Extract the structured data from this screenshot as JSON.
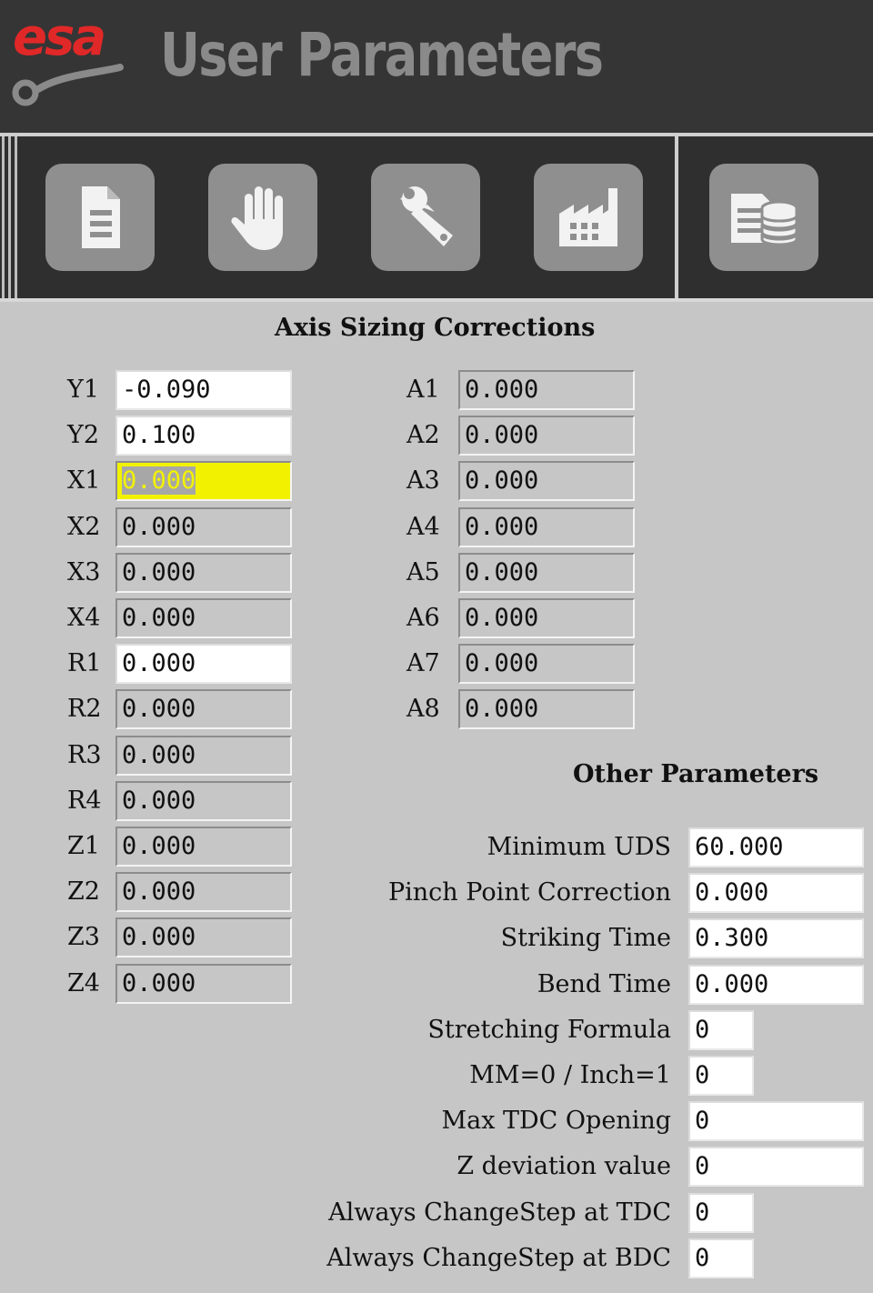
{
  "app": {
    "logo_text": "esa",
    "title": "User Parameters"
  },
  "toolbar": {
    "buttons": [
      {
        "name": "document-button",
        "icon": "document-icon"
      },
      {
        "name": "manual-button",
        "icon": "hand-icon"
      },
      {
        "name": "tools-button",
        "icon": "wrench-icon"
      },
      {
        "name": "factory-button",
        "icon": "factory-icon"
      },
      {
        "name": "database-button",
        "icon": "database-icon"
      }
    ]
  },
  "colors": {
    "header_bg": "#353535",
    "toolbar_bg": "#2f2f2f",
    "panel_bg": "#c6c6c6",
    "title_gray": "#8a8a8a",
    "logo_red": "#e02828",
    "highlight_yellow": "#f2f200"
  },
  "axis_sizing": {
    "title": "Axis Sizing Corrections",
    "left": [
      {
        "label": "Y1",
        "value": "-0.090",
        "state": "editable"
      },
      {
        "label": "Y2",
        "value": "0.100",
        "state": "editable"
      },
      {
        "label": "X1",
        "value": "0.000",
        "state": "selected"
      },
      {
        "label": "X2",
        "value": "0.000",
        "state": "readonly"
      },
      {
        "label": "X3",
        "value": "0.000",
        "state": "readonly"
      },
      {
        "label": "X4",
        "value": "0.000",
        "state": "readonly"
      },
      {
        "label": "R1",
        "value": "0.000",
        "state": "editable"
      },
      {
        "label": "R2",
        "value": "0.000",
        "state": "readonly"
      },
      {
        "label": "R3",
        "value": "0.000",
        "state": "readonly"
      },
      {
        "label": "R4",
        "value": "0.000",
        "state": "readonly"
      },
      {
        "label": "Z1",
        "value": "0.000",
        "state": "readonly"
      },
      {
        "label": "Z2",
        "value": "0.000",
        "state": "readonly"
      },
      {
        "label": "Z3",
        "value": "0.000",
        "state": "readonly"
      },
      {
        "label": "Z4",
        "value": "0.000",
        "state": "readonly"
      }
    ],
    "right": [
      {
        "label": "A1",
        "value": "0.000",
        "state": "readonly"
      },
      {
        "label": "A2",
        "value": "0.000",
        "state": "readonly"
      },
      {
        "label": "A3",
        "value": "0.000",
        "state": "readonly"
      },
      {
        "label": "A4",
        "value": "0.000",
        "state": "readonly"
      },
      {
        "label": "A5",
        "value": "0.000",
        "state": "readonly"
      },
      {
        "label": "A6",
        "value": "0.000",
        "state": "readonly"
      },
      {
        "label": "A7",
        "value": "0.000",
        "state": "readonly"
      },
      {
        "label": "A8",
        "value": "0.000",
        "state": "readonly"
      }
    ]
  },
  "other_parameters": {
    "title": "Other Parameters",
    "items": [
      {
        "label": "Minimum UDS",
        "value": "60.000",
        "size": "wide"
      },
      {
        "label": "Pinch Point Correction",
        "value": "0.000",
        "size": "wide"
      },
      {
        "label": "Striking Time",
        "value": "0.300",
        "size": "wide"
      },
      {
        "label": "Bend Time",
        "value": "0.000",
        "size": "wide"
      },
      {
        "label": "Stretching Formula",
        "value": "0",
        "size": "narrow"
      },
      {
        "label": "MM=0 / Inch=1",
        "value": "0",
        "size": "narrow"
      },
      {
        "label": "Max TDC Opening",
        "value": "0",
        "size": "wide"
      },
      {
        "label": "Z deviation value",
        "value": "0",
        "size": "wide"
      },
      {
        "label": "Always ChangeStep at TDC",
        "value": "0",
        "size": "narrow"
      },
      {
        "label": "Always ChangeStep at BDC",
        "value": "0",
        "size": "narrow"
      }
    ]
  }
}
